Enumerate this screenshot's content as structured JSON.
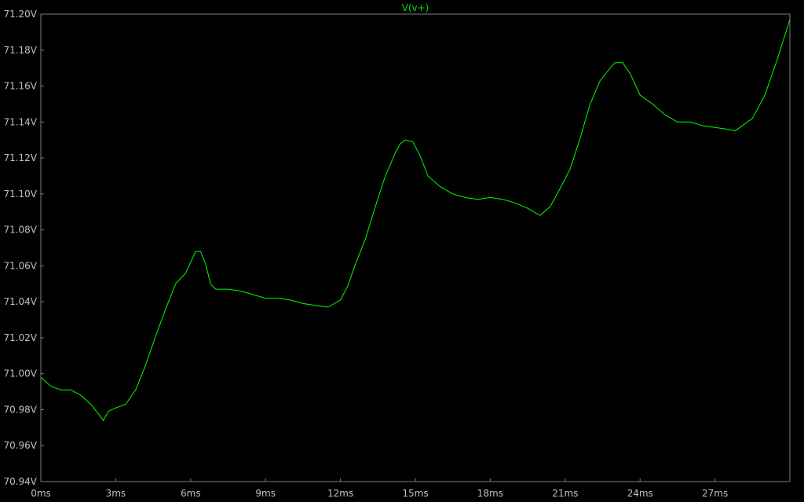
{
  "colors": {
    "background": "#000000",
    "axis": "#808080",
    "text": "#c0c0c0",
    "trace": "#00ff00",
    "trace_label": "#00e000"
  },
  "chart_data": {
    "type": "line",
    "title": "",
    "xlabel": "",
    "ylabel": "",
    "xlim": [
      0,
      30
    ],
    "ylim": [
      70.94,
      71.2
    ],
    "grid": false,
    "legend": "top-center",
    "x_ticks": [
      0,
      3,
      6,
      9,
      12,
      15,
      18,
      21,
      24,
      27
    ],
    "x_tick_labels": [
      "0ms",
      "3ms",
      "6ms",
      "9ms",
      "12ms",
      "15ms",
      "18ms",
      "21ms",
      "24ms",
      "27ms"
    ],
    "y_ticks": [
      70.94,
      70.96,
      70.98,
      71.0,
      71.02,
      71.04,
      71.06,
      71.08,
      71.1,
      71.12,
      71.14,
      71.16,
      71.18,
      71.2
    ],
    "y_tick_labels": [
      "70.94V",
      "70.96V",
      "70.98V",
      "71.00V",
      "71.02V",
      "71.04V",
      "71.06V",
      "71.08V",
      "71.10V",
      "71.12V",
      "71.14V",
      "71.16V",
      "71.18V",
      "71.20V"
    ],
    "series": [
      {
        "name": "V(v+)",
        "color": "#00ff00",
        "x": [
          0,
          0.4,
          0.8,
          1.2,
          1.6,
          2.0,
          2.4,
          2.5,
          2.7,
          3.0,
          3.4,
          3.8,
          4.2,
          4.6,
          5.0,
          5.4,
          5.8,
          6.0,
          6.2,
          6.4,
          6.6,
          6.8,
          7.0,
          7.5,
          8.0,
          8.5,
          9.0,
          9.5,
          10.0,
          10.5,
          11.0,
          11.5,
          12.0,
          12.3,
          12.6,
          13.0,
          13.4,
          13.8,
          14.2,
          14.4,
          14.6,
          14.9,
          15.2,
          15.5,
          16.0,
          16.5,
          17.0,
          17.5,
          18.0,
          18.5,
          19.0,
          19.5,
          20.0,
          20.4,
          20.8,
          21.2,
          21.6,
          22.0,
          22.4,
          22.8,
          23.0,
          23.3,
          23.6,
          24.0,
          24.5,
          25.0,
          25.5,
          26.0,
          26.5,
          27.0,
          27.5,
          27.8,
          28.0,
          28.5,
          29.0,
          29.5,
          30.0
        ],
        "values": [
          70.998,
          70.993,
          70.991,
          70.991,
          70.988,
          70.983,
          70.976,
          70.974,
          70.979,
          70.981,
          70.983,
          70.991,
          71.005,
          71.021,
          71.036,
          71.05,
          71.056,
          71.062,
          71.068,
          71.068,
          71.061,
          71.05,
          71.047,
          71.047,
          71.046,
          71.044,
          71.042,
          71.042,
          71.041,
          71.039,
          71.038,
          71.037,
          71.041,
          71.049,
          71.061,
          71.075,
          71.093,
          71.11,
          71.123,
          71.128,
          71.13,
          71.129,
          71.121,
          71.11,
          71.104,
          71.1,
          71.098,
          71.097,
          71.098,
          71.097,
          71.095,
          71.092,
          71.088,
          71.093,
          71.103,
          71.114,
          71.131,
          71.15,
          71.163,
          71.17,
          71.173,
          71.173,
          71.167,
          71.155,
          71.15,
          71.144,
          71.14,
          71.14,
          71.138,
          71.137,
          71.136,
          71.135,
          71.137,
          71.142,
          71.155,
          71.175,
          71.197
        ]
      }
    ]
  }
}
